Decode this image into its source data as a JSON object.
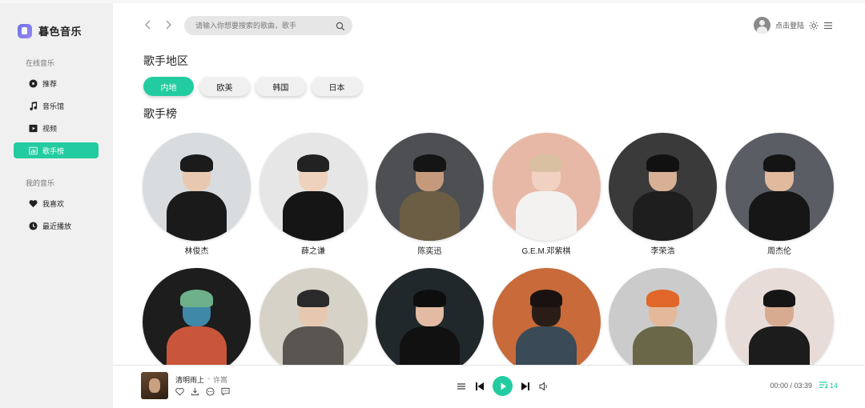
{
  "brand": {
    "name": "暮色音乐"
  },
  "sidebar": {
    "online_label": "在线音乐",
    "online_items": [
      {
        "label": "推荐",
        "icon": "disc-icon"
      },
      {
        "label": "音乐馆",
        "icon": "music-note-icon"
      },
      {
        "label": "视频",
        "icon": "video-icon"
      },
      {
        "label": "歌手榜",
        "icon": "chart-icon",
        "active": true
      }
    ],
    "mine_label": "我的音乐",
    "mine_items": [
      {
        "label": "我喜欢",
        "icon": "heart-icon"
      },
      {
        "label": "最近播放",
        "icon": "clock-icon"
      }
    ]
  },
  "header": {
    "search_placeholder": "请输入你想要搜索的歌曲，歌手",
    "login_text": "点击登陆"
  },
  "regions": {
    "title": "歌手地区",
    "tabs": [
      "内地",
      "欧美",
      "韩国",
      "日本"
    ],
    "active": "内地"
  },
  "ranking": {
    "title": "歌手榜",
    "artists": [
      {
        "name": "林俊杰",
        "bg": "#d8dcdf",
        "skin": "#e8c8b0",
        "cloth": "#1a1a1a",
        "hair": "#1b1b1b"
      },
      {
        "name": "薛之谦",
        "bg": "#e6e6e6",
        "skin": "#efd2bd",
        "cloth": "#151515",
        "hair": "#222222"
      },
      {
        "name": "陈奕迅",
        "bg": "#4d4f52",
        "skin": "#c59a7c",
        "cloth": "#6b5e45",
        "hair": "#151515"
      },
      {
        "name": "G.E.M.邓紫棋",
        "bg": "#e8b8a6",
        "skin": "#f1d2c2",
        "cloth": "#f4f2f0",
        "hair": "#d9c0a0"
      },
      {
        "name": "李荣浩",
        "bg": "#3a3a3a",
        "skin": "#d8b096",
        "cloth": "#1e1e1e",
        "hair": "#111111"
      },
      {
        "name": "周杰伦",
        "bg": "#5a5d63",
        "skin": "#e1b99c",
        "cloth": "#161616",
        "hair": "#141414"
      },
      {
        "name": "",
        "bg": "#1d1d1d",
        "skin": "#3f88a8",
        "cloth": "#c9563a",
        "hair": "#6db08a"
      },
      {
        "name": "",
        "bg": "#d7d2c8",
        "skin": "#e6c8b0",
        "cloth": "#5a5550",
        "hair": "#2a2a2a"
      },
      {
        "name": "",
        "bg": "#20282b",
        "skin": "#e2bba2",
        "cloth": "#111111",
        "hair": "#0e0e0e"
      },
      {
        "name": "",
        "bg": "#c86a3a",
        "skin": "#2a1d18",
        "cloth": "#3a4a56",
        "hair": "#1a1210"
      },
      {
        "name": "",
        "bg": "#cbcbcb",
        "skin": "#e3b99a",
        "cloth": "#6a6648",
        "hair": "#e0662a"
      },
      {
        "name": "",
        "bg": "#e8dcd8",
        "skin": "#d7ab90",
        "cloth": "#1c1c1c",
        "hair": "#151515"
      }
    ]
  },
  "player": {
    "song_title": "清明雨上",
    "separator": "-",
    "song_artist": "许嵩",
    "time": "00:00 / 03:39",
    "playlist_count": "14",
    "accent": "#22cca0"
  }
}
